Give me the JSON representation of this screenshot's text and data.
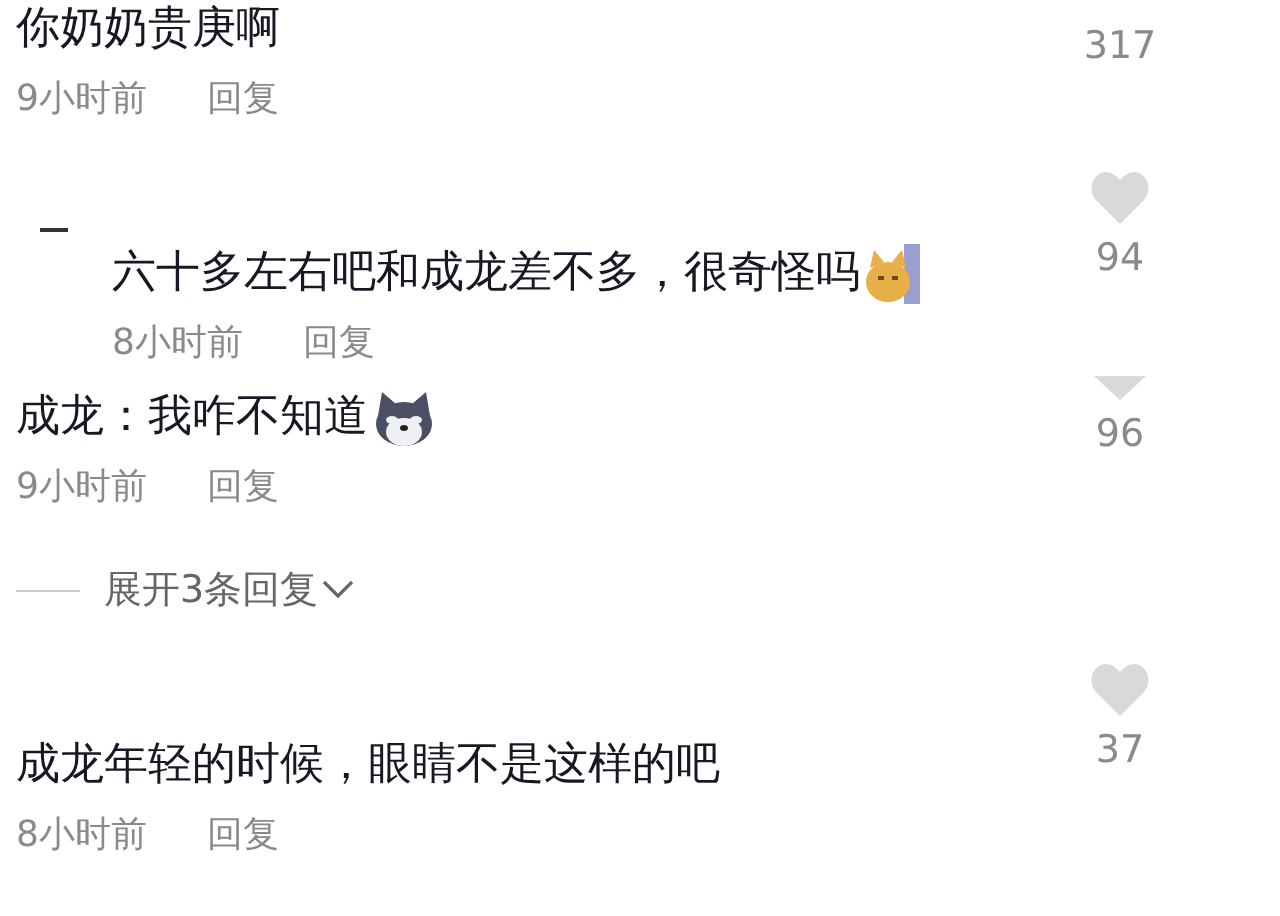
{
  "comments": [
    {
      "kind": "comment",
      "text": "你奶奶贵庚啊",
      "time": "9小时前",
      "reply": "回复",
      "likes": "317"
    },
    {
      "kind": "reply",
      "text": "六十多左右吧和成龙差不多，很奇怪吗",
      "emoji": {
        "kind": "cat"
      },
      "time": "8小时前",
      "reply": "回复",
      "likes": "94",
      "heart": {
        "kind": "full"
      }
    },
    {
      "kind": "comment",
      "text": "成龙：我咋不知道",
      "emoji": {
        "kind": "husky"
      },
      "time": "9小时前",
      "reply": "回复",
      "likes": "96",
      "heart": {
        "kind": "cut"
      },
      "expand": "展开3条回复"
    },
    {
      "kind": "comment",
      "text": "成龙年轻的时候，眼睛不是这样的吧",
      "time": "8小时前",
      "reply": "回复",
      "likes": "37",
      "heart": {
        "kind": "full"
      }
    }
  ]
}
